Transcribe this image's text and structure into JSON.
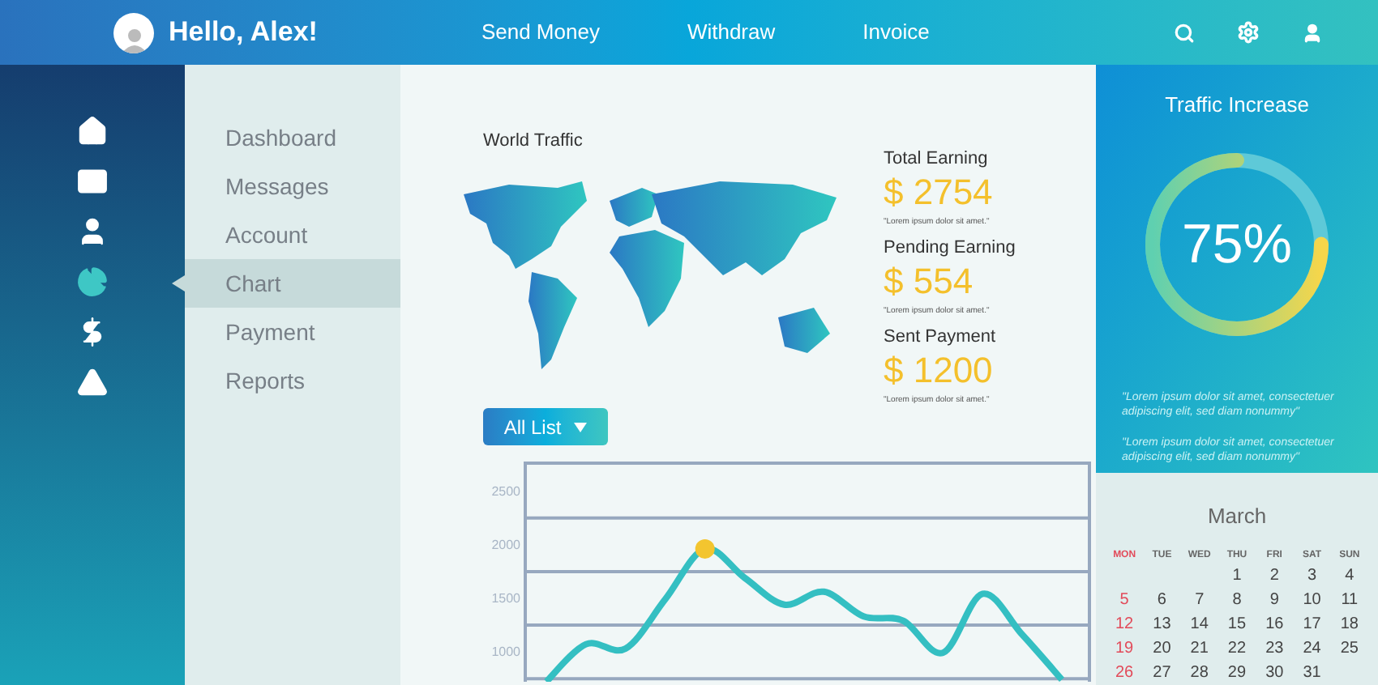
{
  "header": {
    "greeting": "Hello, Alex!",
    "nav": [
      "Send Money",
      "Withdraw",
      "Invoice"
    ]
  },
  "sidebar": {
    "items": [
      {
        "label": "Dashboard",
        "selected": false
      },
      {
        "label": "Messages",
        "selected": false
      },
      {
        "label": "Account",
        "selected": false
      },
      {
        "label": "Chart",
        "selected": true
      },
      {
        "label": "Payment",
        "selected": false
      },
      {
        "label": "Reports",
        "selected": false
      }
    ]
  },
  "map": {
    "title": "World Traffic"
  },
  "stats": [
    {
      "label": "Total Earning",
      "amount": "$ 2754",
      "note": "\"Lorem ipsum dolor sit amet.\""
    },
    {
      "label": "Pending Earning",
      "amount": "$ 554",
      "note": "\"Lorem ipsum dolor sit amet.\""
    },
    {
      "label": "Sent Payment",
      "amount": "$ 1200",
      "note": "\"Lorem ipsum dolor sit amet.\""
    }
  ],
  "dropdown": {
    "label": "All List"
  },
  "line_chart": {
    "chart_data": {
      "type": "line",
      "series": [
        {
          "color": "#34bfc2",
          "values": [
            730,
            1080,
            1040,
            1500,
            1970,
            1700,
            1450,
            1570,
            1340,
            1300,
            1000,
            1550,
            1170,
            750
          ]
        }
      ],
      "ylim": [
        730,
        2770
      ],
      "yticks": [
        2500,
        2000,
        1500,
        1000
      ]
    }
  },
  "traffic": {
    "title": "Traffic Increase",
    "level": 0.75,
    "reading": "75%",
    "notes": [
      "\"Lorem ipsum dolor sit amet, consectetuer adipiscing elit, sed diam nonummy\"",
      "\"Lorem ipsum dolor sit amet, consectetuer adipiscing elit, sed diam nonummy\""
    ]
  },
  "calendar": {
    "month": "March",
    "weekdays": [
      {
        "label": "MON",
        "weekend": true
      },
      {
        "label": "TUE",
        "weekend": false
      },
      {
        "label": "WED",
        "weekend": false
      },
      {
        "label": "THU",
        "weekend": false
      },
      {
        "label": "FRI",
        "weekend": false
      },
      {
        "label": "SAT",
        "weekend": false
      },
      {
        "label": "SUN",
        "weekend": false
      }
    ],
    "weeks": [
      {
        "thu": "1",
        "fri": "2",
        "sat": "3",
        "sun": "4"
      },
      {
        "mon": "5",
        "tue": "6",
        "wed": "7",
        "thu": "8",
        "fri": "9",
        "sat": "10",
        "sun": "11"
      },
      {
        "mon": "12",
        "tue": "13",
        "wed": "14",
        "thu": "15",
        "fri": "16",
        "sat": "17",
        "sun": "18"
      },
      {
        "mon": "19",
        "tue": "20",
        "wed": "21",
        "thu": "22",
        "fri": "23",
        "sat": "24",
        "sun": "25"
      },
      {
        "mon": "26",
        "tue": "27",
        "wed": "28",
        "thu": "29",
        "fri": "30",
        "sat": "31"
      }
    ]
  }
}
